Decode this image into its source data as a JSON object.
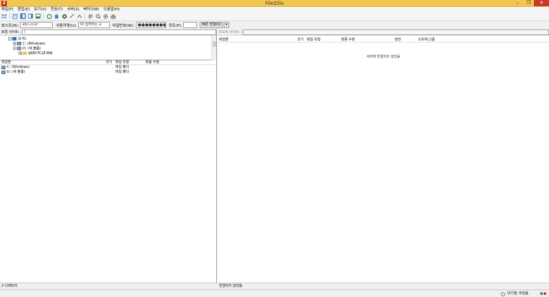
{
  "window": {
    "title": "FileZilla",
    "app_icon": "Z",
    "minimize": "–",
    "maximize": "❐",
    "close": "✕"
  },
  "menu": [
    "파일(F)",
    "편집(E)",
    "보기(V)",
    "전송(T)",
    "서버(S)",
    "북마크(B)",
    "도움말(H)"
  ],
  "toolbar_icons": [
    "site-manager-icon",
    "toggle-log-icon",
    "toggle-local-tree-icon",
    "toggle-remote-tree-icon",
    "toggle-queue-icon",
    "refresh-icon",
    "process-queue-icon",
    "cancel-icon",
    "disconnect-icon",
    "reconnect-icon",
    "filter-icon",
    "search-icon",
    "compare-icon",
    "find-icon"
  ],
  "quickconnect": {
    "host_label": "호스트(H):",
    "host_value": "abc.co.kr",
    "user_label": "사용자명(U):",
    "user_value": "ID 입력하는 곳",
    "pass_label": "비밀번호(W):",
    "pass_value": "●●●●●●●●",
    "port_label": "포트(P):",
    "port_value": "",
    "connect_label": "빠른 연결(Q)",
    "dropdown": "▾"
  },
  "local": {
    "site_label": "로컬 사이트:",
    "path": "\\",
    "tree": [
      {
        "label": "내 PC",
        "expander": "−",
        "icon": "pc"
      },
      {
        "label": "C: (Windows)",
        "expander": "+",
        "icon": "drive"
      },
      {
        "label": "D: (새 볼륨)",
        "expander": "−",
        "icon": "drive"
      },
      {
        "label": "$RECYCLE.BIN",
        "expander": "+",
        "icon": "folder"
      }
    ],
    "columns": {
      "name": "파일명",
      "size": "크기",
      "type": "파일 유형",
      "modified": "최종 수정"
    },
    "files": [
      {
        "name": "C: (Windows)",
        "type": "파일 폴더"
      },
      {
        "name": "D: (새 볼륨)",
        "type": "파일 폴더"
      }
    ],
    "status": "2 디렉터리"
  },
  "remote": {
    "site_label": "리모트 사이트:",
    "path": "",
    "columns": {
      "name": "파일명",
      "size": "크기",
      "type": "파일 유형",
      "modified": "최종 수정",
      "perms": "권한",
      "owner": "소유자/그룹"
    },
    "empty_message": "서버에 연결되지 않았음",
    "status": "연결되지 않았음."
  },
  "queue": {
    "label": "대기열: 비었음"
  },
  "colors": {
    "titlebar": "#f2c74f",
    "close_button": "#c7392b",
    "led_green": "#2e9e3a",
    "led_red": "#d03030"
  }
}
